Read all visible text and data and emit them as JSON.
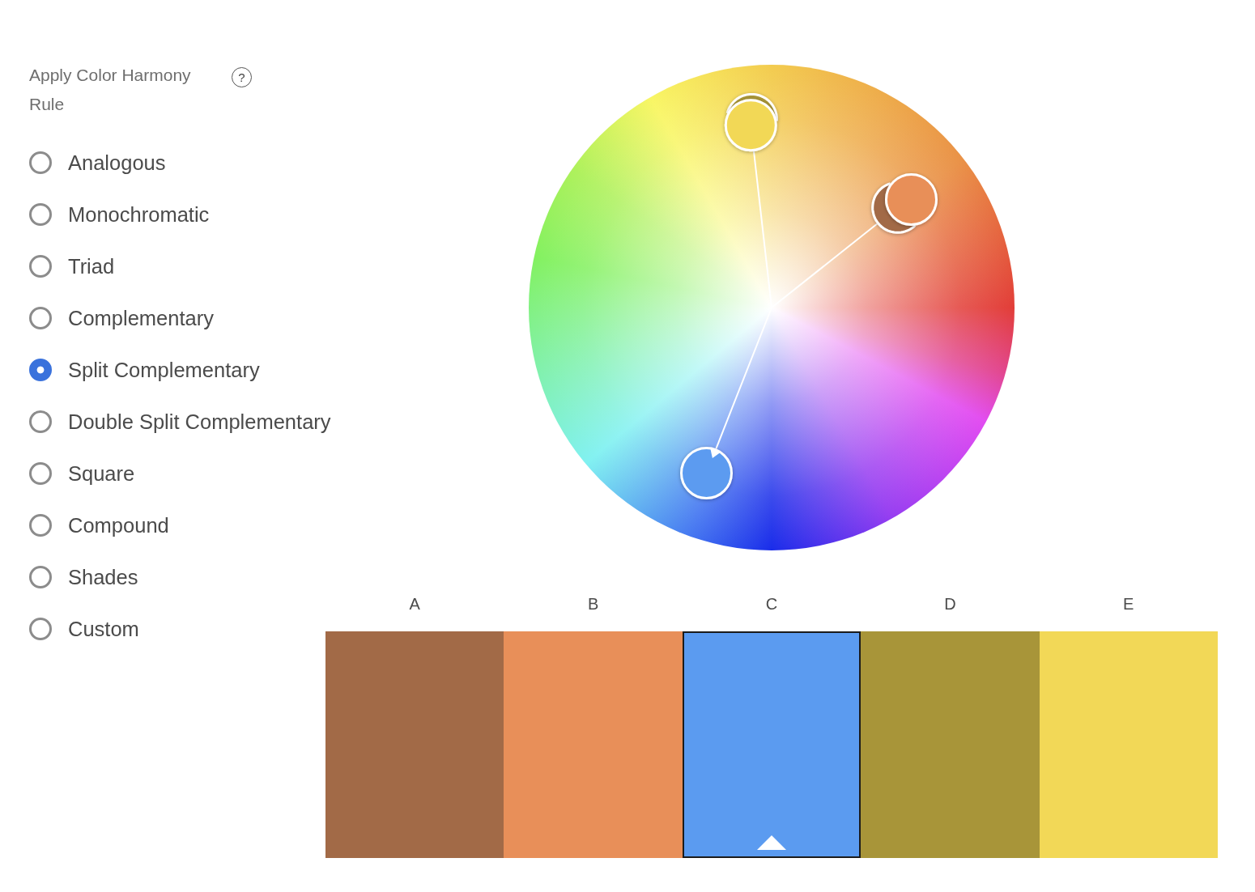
{
  "panel": {
    "title": "Apply Color Harmony Rule",
    "help": "?"
  },
  "rules": [
    {
      "label": "Analogous",
      "selected": false
    },
    {
      "label": "Monochromatic",
      "selected": false
    },
    {
      "label": "Triad",
      "selected": false
    },
    {
      "label": "Complementary",
      "selected": false
    },
    {
      "label": "Split Complementary",
      "selected": true
    },
    {
      "label": "Double Split Complementary",
      "selected": false
    },
    {
      "label": "Square",
      "selected": false
    },
    {
      "label": "Compound",
      "selected": false
    },
    {
      "label": "Shades",
      "selected": false
    },
    {
      "label": "Custom",
      "selected": false
    }
  ],
  "swatches": [
    {
      "label": "A",
      "color": "#a26a47",
      "selected": false
    },
    {
      "label": "B",
      "color": "#e88f59",
      "selected": false
    },
    {
      "label": "C",
      "color": "#5b9bf0",
      "selected": true
    },
    {
      "label": "D",
      "color": "#a89539",
      "selected": false
    },
    {
      "label": "E",
      "color": "#f2d857",
      "selected": false
    }
  ]
}
